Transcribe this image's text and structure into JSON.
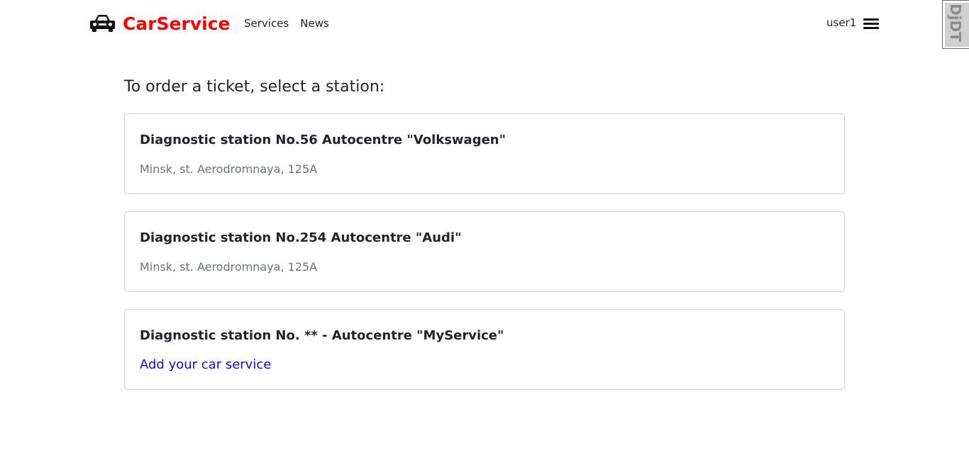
{
  "navbar": {
    "brand": "CarService",
    "brand_icon": "car-icon",
    "brand_color": "#ff0000",
    "links": [
      "Services",
      "News"
    ],
    "user": "user1",
    "menu_icon": "hamburger-menu-icon"
  },
  "debug_toolbar": {
    "label": "DjDT"
  },
  "main": {
    "heading": "To order a ticket, select a station:",
    "stations": [
      {
        "title": "Diagnostic station No.56 Autocentre \"Volkswagen\"",
        "address": "Minsk, st. Aerodromnaya, 125A"
      },
      {
        "title": "Diagnostic station No.254 Autocentre \"Audi\"",
        "address": "Minsk, st. Aerodromnaya, 125A"
      }
    ],
    "add_card": {
      "title": "Diagnostic station No. ** - Autocentre \"MyService\"",
      "link": "Add your car service"
    }
  },
  "colors": {
    "link": "#0d0dd6",
    "muted_text": "#6c757d",
    "text": "#212529"
  }
}
